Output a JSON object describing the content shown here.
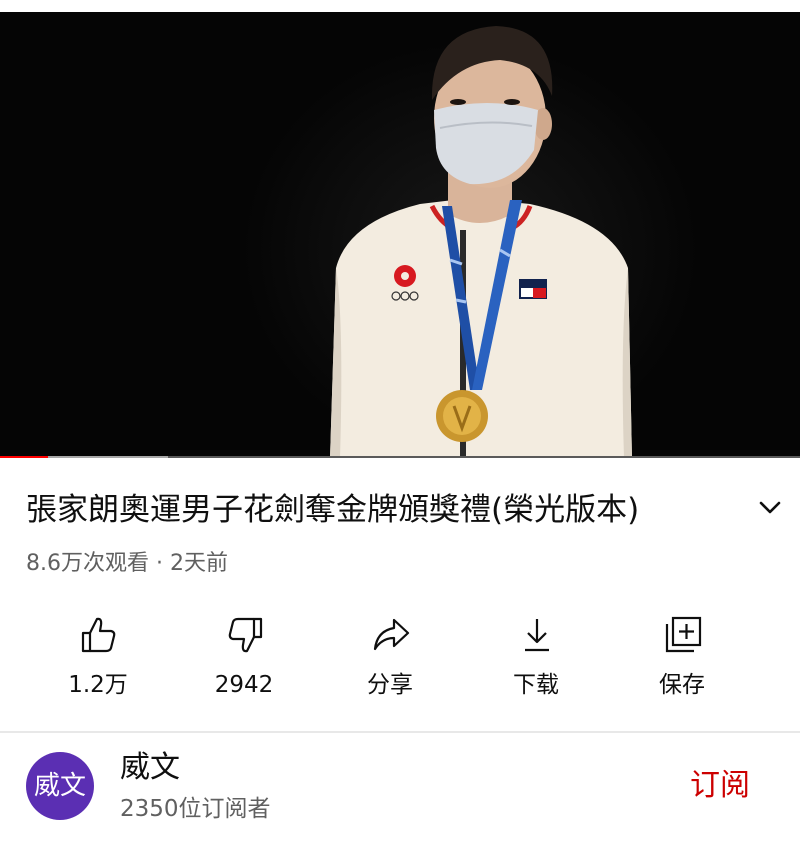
{
  "video": {
    "title": "張家朗奧運男子花劍奪金牌頒獎禮(榮光版本)",
    "meta": "8.6万次观看 · 2天前",
    "progress_played": 0.06,
    "progress_buffered": 0.21,
    "colors": {
      "progress": "#ff0000",
      "subscribe": "#cc0000",
      "avatar": "#5b2fb3"
    }
  },
  "actions": [
    {
      "icon": "thumbs-up-icon",
      "label": "1.2万"
    },
    {
      "icon": "thumbs-down-icon",
      "label": "2942"
    },
    {
      "icon": "share-icon",
      "label": "分享"
    },
    {
      "icon": "download-icon",
      "label": "下载"
    },
    {
      "icon": "save-playlist-icon",
      "label": "保存"
    }
  ],
  "channel": {
    "avatar_text": "威文",
    "name": "威文",
    "subscribers": "2350位订阅者",
    "subscribe_label": "订阅"
  }
}
